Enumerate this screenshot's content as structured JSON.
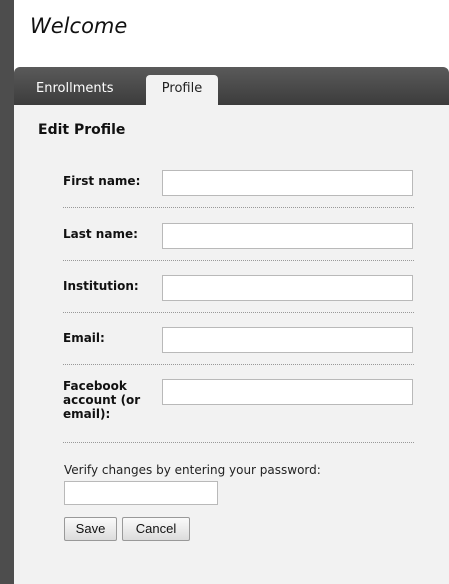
{
  "header": {
    "title": "Welcome"
  },
  "tabs": [
    {
      "label": "Enrollments",
      "active": false
    },
    {
      "label": "Profile",
      "active": true
    }
  ],
  "form": {
    "heading": "Edit Profile",
    "fields": [
      {
        "label": "First name:",
        "value": ""
      },
      {
        "label": "Last name:",
        "value": ""
      },
      {
        "label": "Institution:",
        "value": ""
      },
      {
        "label": "Email:",
        "value": ""
      },
      {
        "label": "Facebook account (or email):",
        "value": ""
      }
    ],
    "verify_label": "Verify changes by entering your password:",
    "password_value": "",
    "save_label": "Save",
    "cancel_label": "Cancel"
  },
  "colors": {
    "background": "#4d4d4d",
    "tabbar": "#4a4a4a",
    "panel": "#f2f2f2"
  }
}
